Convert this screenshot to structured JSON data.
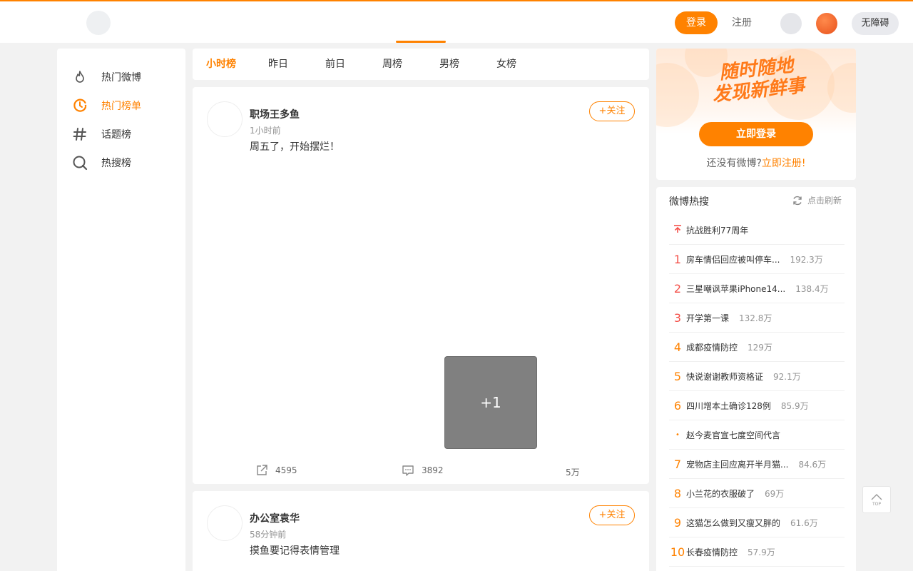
{
  "header": {
    "login_label": "登录",
    "register_label": "注册",
    "accessibility_label": "无障碍"
  },
  "sidebar": {
    "items": [
      {
        "label": "热门微博",
        "icon": "flame-icon",
        "active": false
      },
      {
        "label": "热门榜单",
        "icon": "clock-icon",
        "active": true
      },
      {
        "label": "话题榜",
        "icon": "hashtag-icon",
        "active": false
      },
      {
        "label": "热搜榜",
        "icon": "search-icon",
        "active": false
      }
    ]
  },
  "tabs": [
    {
      "label": "小时榜",
      "active": true
    },
    {
      "label": "昨日",
      "active": false
    },
    {
      "label": "前日",
      "active": false
    },
    {
      "label": "周榜",
      "active": false
    },
    {
      "label": "男榜",
      "active": false
    },
    {
      "label": "女榜",
      "active": false
    }
  ],
  "posts": [
    {
      "author": "职场王多鱼",
      "time": "1小时前",
      "content": "周五了，开始摆烂！",
      "follow_label": "+关注",
      "image_more": "+1",
      "reposts": "4595",
      "comments": "3892",
      "likes": "5万"
    },
    {
      "author": "办公室袁华",
      "time": "58分钟前",
      "content": "摸鱼要记得表情管理",
      "follow_label": "+关注"
    }
  ],
  "login_card": {
    "slogan_line1": "随时随地",
    "slogan_line2": "发现新鲜事",
    "login_now_label": "立即登录",
    "no_account_text": "还没有微博?",
    "register_link": "立即注册!"
  },
  "hot_search": {
    "title": "微博热搜",
    "refresh_label": "点击刷新",
    "items": [
      {
        "rank": "",
        "rank_type": "pin",
        "title": "抗战胜利77周年",
        "count": ""
      },
      {
        "rank": "1",
        "rank_type": "top3",
        "title": "房车情侣回应被叫停车...",
        "count": "192.3万"
      },
      {
        "rank": "2",
        "rank_type": "top3",
        "title": "三星嘲讽苹果iPhone14...",
        "count": "138.4万"
      },
      {
        "rank": "3",
        "rank_type": "top3",
        "title": "开学第一课",
        "count": "132.8万"
      },
      {
        "rank": "4",
        "rank_type": "normal",
        "title": "成都疫情防控",
        "count": "129万"
      },
      {
        "rank": "5",
        "rank_type": "normal",
        "title": "快说谢谢教师资格证",
        "count": "92.1万"
      },
      {
        "rank": "6",
        "rank_type": "normal",
        "title": "四川增本土确诊128例",
        "count": "85.9万"
      },
      {
        "rank": "•",
        "rank_type": "dot",
        "title": "赵今麦官宣七度空间代言",
        "count": ""
      },
      {
        "rank": "7",
        "rank_type": "normal",
        "title": "宠物店主回应离开半月猫...",
        "count": "84.6万"
      },
      {
        "rank": "8",
        "rank_type": "normal",
        "title": "小兰花的衣服破了",
        "count": "69万"
      },
      {
        "rank": "9",
        "rank_type": "normal",
        "title": "这猫怎么做到又瘦又胖的",
        "count": "61.6万"
      },
      {
        "rank": "10",
        "rank_type": "normal",
        "title": "长春疫情防控",
        "count": "57.9万"
      }
    ]
  },
  "back_to_top_label": "TOP",
  "colors": {
    "accent": "#ff8200",
    "hot_red": "#f45049"
  }
}
